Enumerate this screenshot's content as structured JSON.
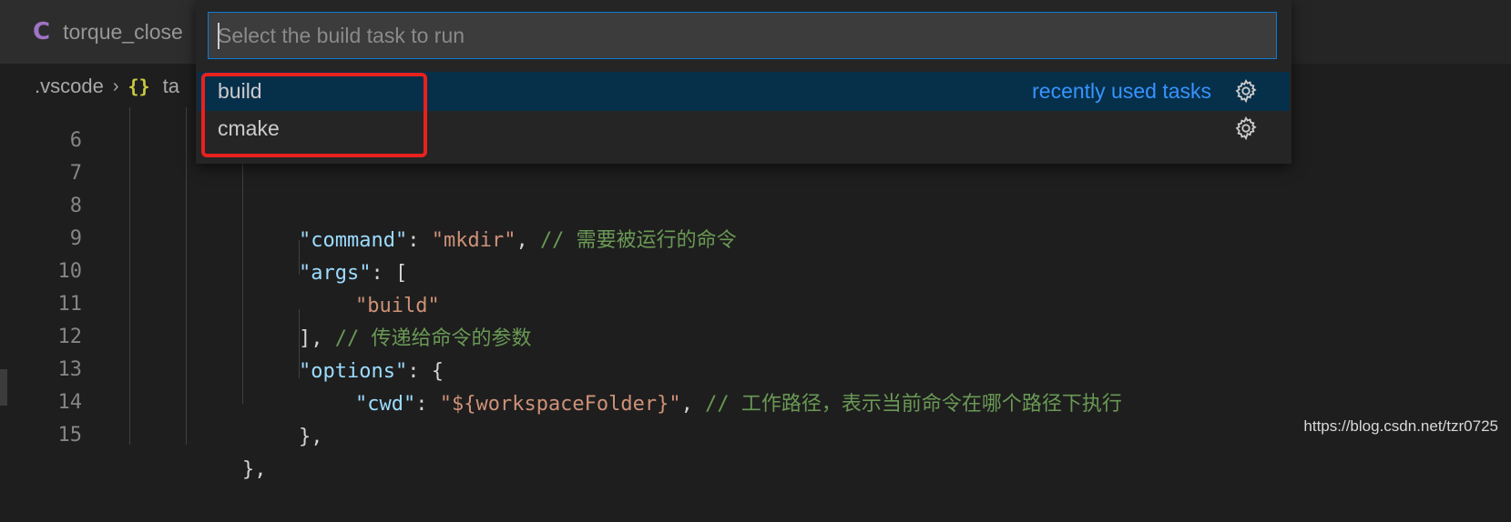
{
  "tab": {
    "icon": "C",
    "label": "torque_close"
  },
  "breadcrumb": {
    "folder": ".vscode",
    "separator": "›",
    "braces": "{}",
    "file": "ta"
  },
  "quick_pick": {
    "placeholder": "Select the build task to run",
    "items": [
      {
        "label": "build",
        "description": "recently used tasks",
        "icon": "gear-icon",
        "selected": true
      },
      {
        "label": "cmake",
        "description": "",
        "icon": "gear-icon",
        "selected": false
      }
    ]
  },
  "editor": {
    "lines": [
      {
        "number": "6"
      },
      {
        "number": "7"
      },
      {
        "number": "8",
        "key": "\"command\"",
        "colon": ": ",
        "value": "\"mkdir\"",
        "trail": ", ",
        "comment": "// 需要被运行的命令"
      },
      {
        "number": "9",
        "key": "\"args\"",
        "colon": ": ",
        "punct": "["
      },
      {
        "number": "10",
        "value": "\"build\""
      },
      {
        "number": "11",
        "punct": "],",
        "comment": " // 传递给命令的参数"
      },
      {
        "number": "12",
        "key": "\"options\"",
        "colon": ": ",
        "punct": "{"
      },
      {
        "number": "13",
        "key": "\"cwd\"",
        "colon": ": ",
        "value": "\"${workspaceFolder}\"",
        "trail": ", ",
        "comment": "// 工作路径，表示当前命令在哪个路径下执行"
      },
      {
        "number": "14",
        "punct": "},"
      },
      {
        "number": "15",
        "punct": "},"
      }
    ]
  },
  "colors": {
    "accent_border": "#0e7ad3",
    "selected_row": "#062f4a",
    "description": "#3794ff",
    "highlight_box": "#e8211e"
  },
  "watermark": "https://blog.csdn.net/tzr0725"
}
